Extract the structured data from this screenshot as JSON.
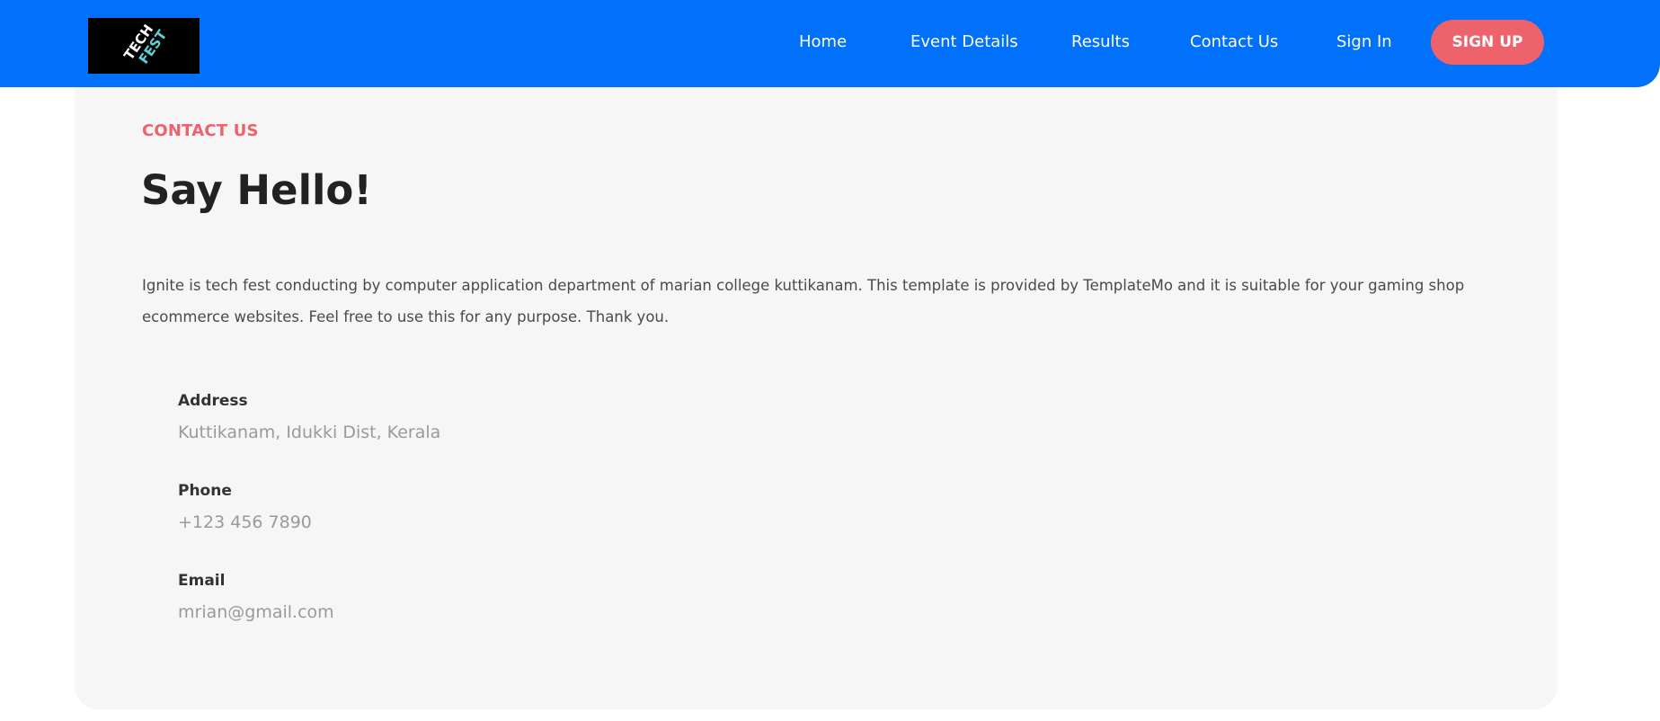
{
  "header": {
    "logo_alt": "TECH FEST",
    "nav": [
      {
        "label": "Home"
      },
      {
        "label": "Event Details"
      },
      {
        "label": "Results"
      },
      {
        "label": "Contact Us"
      },
      {
        "label": "Sign In"
      }
    ],
    "signup_label": "SIGN UP"
  },
  "contact": {
    "section_label": "CONTACT US",
    "title": "Say Hello!",
    "description": "Ignite is tech fest conducting by computer application department of marian college kuttikanam. This template is provided by TemplateMo and it is suitable for your gaming shop ecommerce websites. Feel free to use this for any purpose. Thank you.",
    "address": {
      "label": "Address",
      "value": "Kuttikanam, Idukki Dist, Kerala"
    },
    "phone": {
      "label": "Phone",
      "value": "+123 456 7890"
    },
    "email": {
      "label": "Email",
      "value": "mrian@gmail.com"
    }
  },
  "colors": {
    "header_bg": "#0071f8",
    "accent": "#ee626b",
    "card_bg": "#f6f6f6"
  }
}
